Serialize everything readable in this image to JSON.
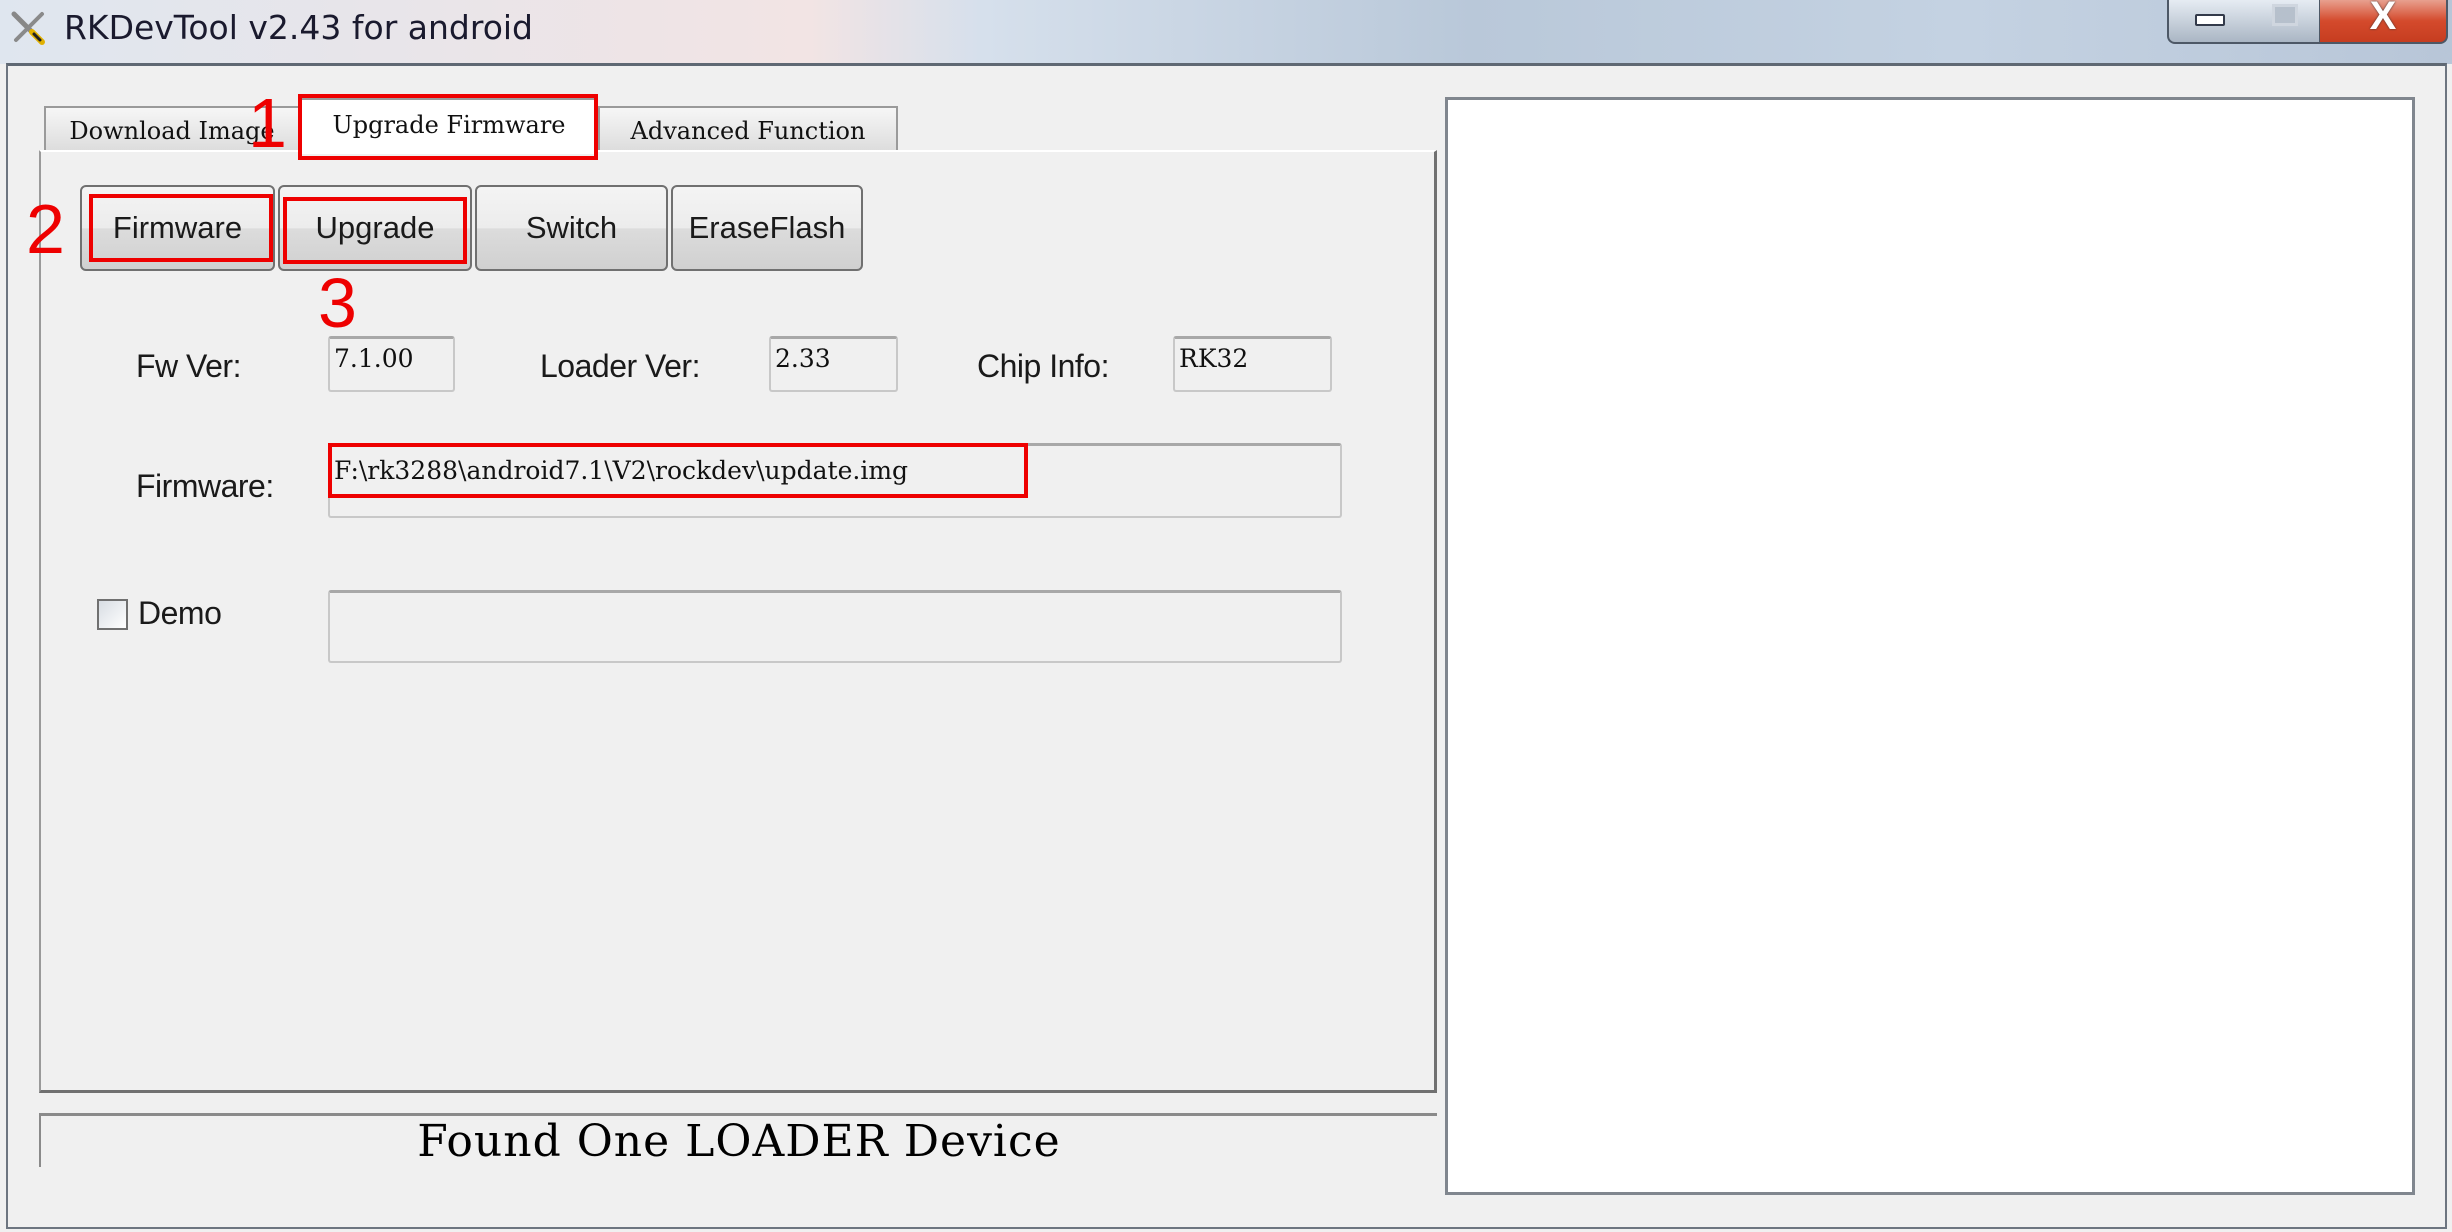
{
  "window": {
    "title": "RKDevTool v2.43 for android",
    "controls": {
      "minimize": "minimize",
      "maximize": "maximize",
      "close": "X"
    }
  },
  "tabs": [
    {
      "label": "Download Image",
      "active": false
    },
    {
      "label": "Upgrade Firmware",
      "active": true
    },
    {
      "label": "Advanced Function",
      "active": false
    }
  ],
  "toolbar": {
    "firmware_label": "Firmware",
    "upgrade_label": "Upgrade",
    "switch_label": "Switch",
    "eraseflash_label": "EraseFlash"
  },
  "info": {
    "fw_ver_label": "Fw Ver:",
    "fw_ver_value": "7.1.00",
    "loader_ver_label": "Loader Ver:",
    "loader_ver_value": "2.33",
    "chip_info_label": "Chip Info:",
    "chip_info_value": "RK32"
  },
  "firmware": {
    "label": "Firmware:",
    "path": "F:\\rk3288\\android7.1\\V2\\rockdev\\update.img"
  },
  "demo": {
    "label": "Demo",
    "checked": false,
    "value": ""
  },
  "status": {
    "text": "Found One LOADER Device"
  },
  "log": {
    "content": ""
  },
  "annotations": {
    "step1": "1",
    "step2": "2",
    "step3": "3",
    "color": "#ee0000"
  }
}
